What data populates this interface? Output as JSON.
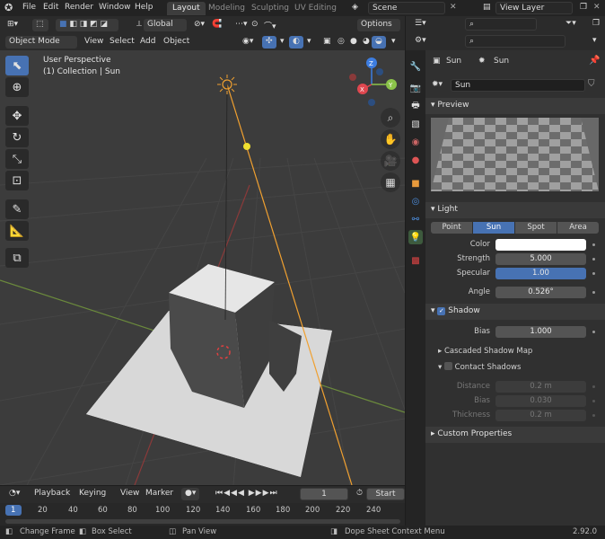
{
  "topbar": {
    "menus": [
      "File",
      "Edit",
      "Render",
      "Window",
      "Help"
    ],
    "workspaces": [
      "Layout",
      "Modeling",
      "Sculpting",
      "UV Editing"
    ],
    "scene": "Scene",
    "view_layer": "View Layer"
  },
  "viewport_header": {
    "transform_orientation": "Global",
    "options": "Options",
    "mode": "Object Mode",
    "menus": [
      "View",
      "Select",
      "Add",
      "Object"
    ]
  },
  "viewport": {
    "overlay_title": "User Perspective",
    "overlay_subtitle": "(1) Collection | Sun",
    "gizmo_axes": [
      "X",
      "Y",
      "Z"
    ]
  },
  "properties": {
    "breadcrumb_object": "Sun",
    "breadcrumb_data": "Sun",
    "datablock_name": "Sun",
    "preview_label": "Preview",
    "light_label": "Light",
    "light_types": [
      "Point",
      "Sun",
      "Spot",
      "Area"
    ],
    "active_light_type": "Sun",
    "color_label": "Color",
    "color_value": "#ffffff",
    "strength_label": "Strength",
    "strength_value": "5.000",
    "specular_label": "Specular",
    "specular_value": "1.00",
    "angle_label": "Angle",
    "angle_value": "0.526°",
    "shadow_label": "Shadow",
    "bias_label": "Bias",
    "bias_value": "1.000",
    "cascaded_label": "Cascaded Shadow Map",
    "contact_label": "Contact Shadows",
    "distance_label": "Distance",
    "distance_value": "0.2 m",
    "contact_bias_label": "Bias",
    "contact_bias_value": "0.030",
    "thickness_label": "Thickness",
    "thickness_value": "0.2 m",
    "custom_props_label": "Custom Properties"
  },
  "timeline": {
    "menus": [
      "Playback",
      "Keying",
      "View",
      "Marker"
    ],
    "current_frame": "1",
    "start_label": "Start",
    "ruler": [
      "1",
      "20",
      "40",
      "60",
      "80",
      "100",
      "120",
      "140",
      "160",
      "180",
      "200",
      "220",
      "240"
    ]
  },
  "statusbar": {
    "change_frame": "Change Frame",
    "box_select": "Box Select",
    "pan_view": "Pan View",
    "context_menu": "Dope Sheet Context Menu",
    "version": "2.92.0"
  },
  "colors": {
    "accent": "#4772b3",
    "sun_line": "#f0a030",
    "x_axis": "#e0474f",
    "y_axis": "#8bc34a",
    "z_axis": "#3d7de0"
  }
}
